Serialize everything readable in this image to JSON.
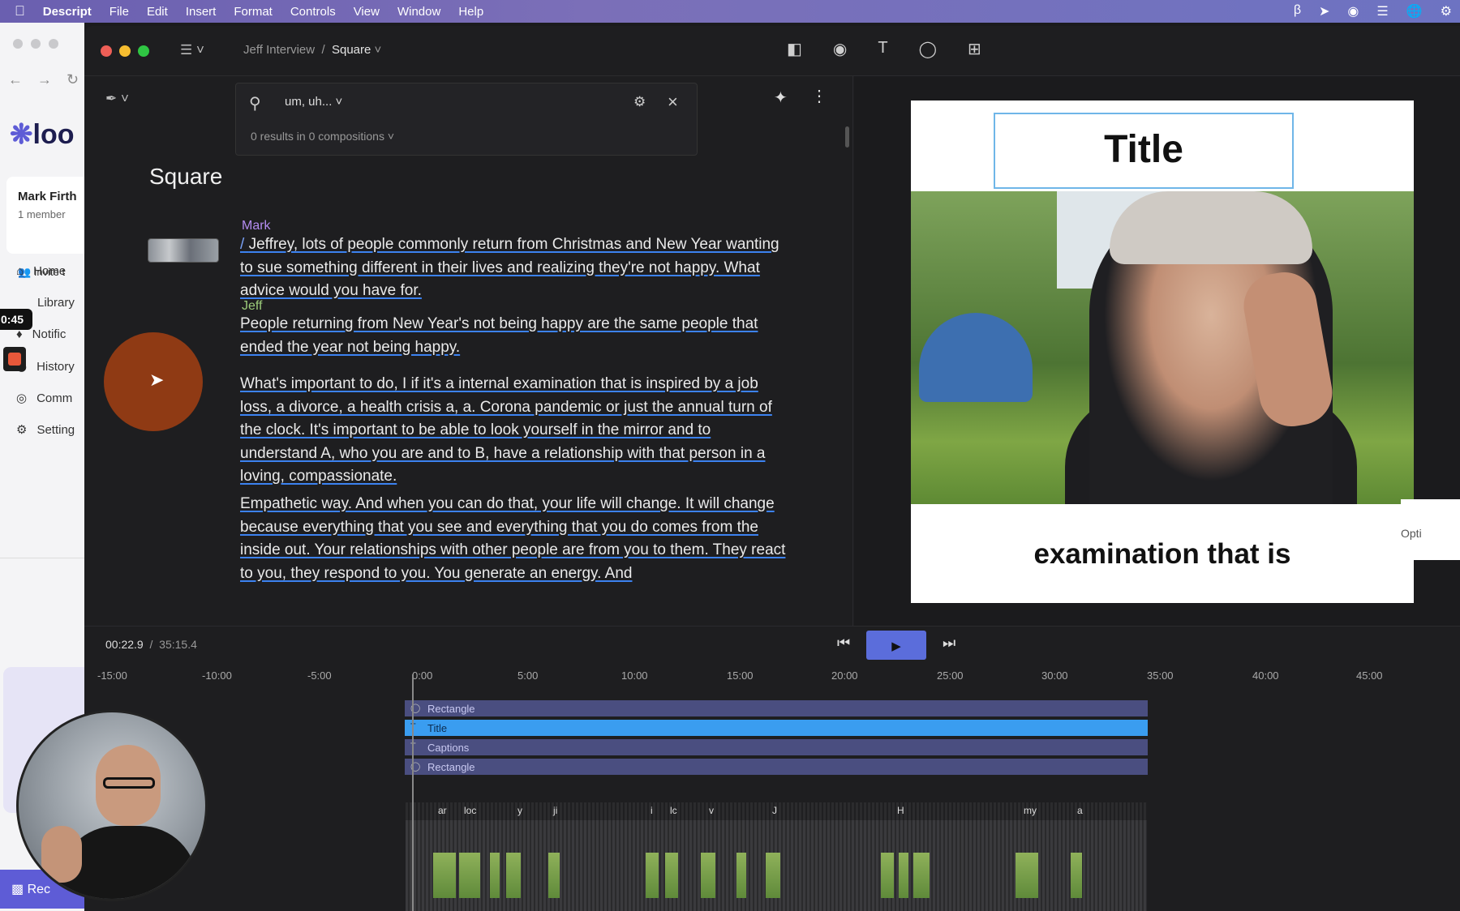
{
  "menubar": {
    "app_name": "Descript",
    "items": [
      "File",
      "Edit",
      "Insert",
      "Format",
      "Controls",
      "View",
      "Window",
      "Help"
    ]
  },
  "background_app": {
    "logo_text": "loo",
    "workspace_name": "Mark Firth",
    "workspace_members": "1 member",
    "invite_label": "Invite t",
    "nav": [
      "Home",
      "Library",
      "Notific",
      "History",
      "Comm",
      "Setting"
    ],
    "record_label": "Rec",
    "recording_time": "0:45"
  },
  "window": {
    "breadcrumb_project": "Jeff Interview",
    "breadcrumb_separator": "/",
    "breadcrumb_composition": "Square"
  },
  "search": {
    "query": "um, uh...",
    "results_text": "0 results in 0 compositions"
  },
  "script": {
    "composition_title": "Square",
    "blocks": [
      {
        "speaker": "Mark",
        "text": "Jeffrey, lots of people commonly return from Christmas and New Year wanting to sue something different in their lives and realizing they're not happy. What advice would you have for."
      },
      {
        "speaker": "Jeff",
        "text": "People returning from New Year's not being happy are the same people that ended the year not being happy."
      },
      {
        "speaker": "",
        "text": "What's important to do, I if it's a internal examination that is inspired by a job loss, a divorce, a health crisis a, a. Corona pandemic or just the annual turn of the clock. It's important to be able to look yourself in the mirror and to understand A, who you are and to B, have a relationship with that person in a loving, compassionate."
      },
      {
        "speaker": "",
        "text": "Empathetic way. And when you can do that, your life will change. It will change because everything that you see and everything that you do comes from the inside out. Your relationships with other people are from you to them. They react to you, they respond to you. You generate an energy. And"
      }
    ]
  },
  "preview": {
    "title_text": "Title",
    "caption_text": "examination that is",
    "side_label": "Opti"
  },
  "transport": {
    "current_time": "00:22.9",
    "separator": "/",
    "total_time": "35:15.4"
  },
  "timeline": {
    "ruler": [
      "-15:00",
      "-10:00",
      "-5:00",
      "0:00",
      "5:00",
      "10:00",
      "15:00",
      "20:00",
      "25:00",
      "30:00",
      "35:00",
      "40:00",
      "45:00"
    ],
    "tracks": [
      "Rectangle",
      "Title",
      "Captions",
      "Rectangle"
    ],
    "word_labels": [
      "ar",
      "loc",
      "y",
      "ji",
      "i",
      "lc",
      "v",
      "J",
      "H",
      "my",
      "a"
    ]
  },
  "colors": {
    "accent_blue": "#3c82f0",
    "play_button": "#5b6ddb",
    "speaker_mark": "#b48cf0",
    "speaker_jeff": "#9ccc7a",
    "title_track": "#3a9df0",
    "rect_track": "#4a4e80"
  }
}
